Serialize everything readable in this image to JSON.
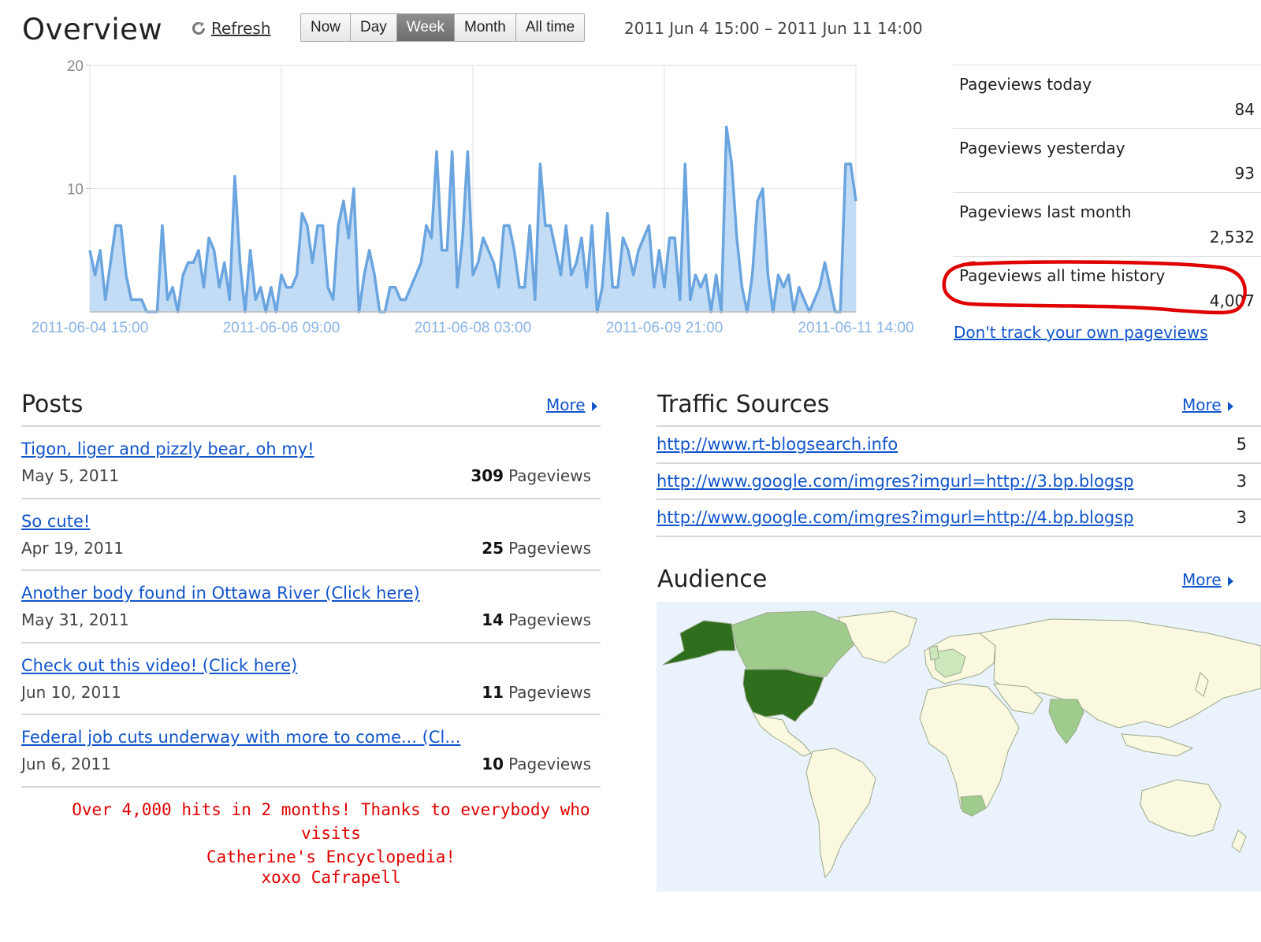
{
  "header": {
    "title": "Overview",
    "refresh_label": "Refresh",
    "ranges": [
      {
        "label": "Now",
        "active": false
      },
      {
        "label": "Day",
        "active": false
      },
      {
        "label": "Week",
        "active": true
      },
      {
        "label": "Month",
        "active": false
      },
      {
        "label": "All time",
        "active": false
      }
    ],
    "date_range": "2011 Jun 4 15:00 – 2011 Jun 11 14:00"
  },
  "chart_data": {
    "type": "area",
    "ylim": [
      0,
      20
    ],
    "yticks": [
      "20",
      "10"
    ],
    "xtick_labels": [
      "2011-06-04 15:00",
      "2011-06-06 09:00",
      "2011-06-08 03:00",
      "2011-06-09 21:00",
      "2011-06-11 14:00"
    ],
    "x_range": [
      "2011-06-04 15:00",
      "2011-06-11 14:00"
    ],
    "grid": true,
    "colors": {
      "line": "#6aa5e0",
      "fill": "#c3dcf5",
      "grid": "#e2e2e2",
      "axis": "#bbbbbb",
      "xtick": "#8ab4e6"
    },
    "values": [
      5,
      3,
      5,
      1,
      4,
      7,
      7,
      3,
      1,
      1,
      1,
      0,
      0,
      0,
      7,
      1,
      2,
      0,
      3,
      4,
      4,
      5,
      2,
      6,
      5,
      2,
      4,
      1,
      11,
      4,
      0,
      5,
      1,
      2,
      0,
      2,
      0,
      3,
      2,
      2,
      3,
      8,
      7,
      4,
      7,
      7,
      2,
      1,
      7,
      9,
      6,
      10,
      0,
      3,
      5,
      3,
      0,
      0,
      2,
      2,
      1,
      1,
      2,
      3,
      4,
      7,
      6,
      13,
      5,
      5,
      13,
      2,
      6,
      13,
      3,
      4,
      6,
      5,
      4,
      2,
      7,
      7,
      5,
      2,
      2,
      7,
      1,
      12,
      7,
      7,
      5,
      3,
      7,
      3,
      4,
      6,
      2,
      7,
      0,
      2,
      8,
      2,
      2,
      6,
      5,
      3,
      5,
      6,
      7,
      2,
      5,
      2,
      6,
      6,
      1,
      12,
      1,
      3,
      2,
      3,
      0,
      3,
      0,
      15,
      12,
      6,
      2,
      0,
      3,
      9,
      10,
      3,
      0,
      3,
      2,
      3,
      0,
      2,
      1,
      0,
      1,
      2,
      4,
      2,
      0,
      0,
      12,
      12,
      9
    ],
    "series": [
      {
        "values_ref": "values"
      }
    ]
  },
  "stats": [
    {
      "label": "Pageviews today",
      "value": "84"
    },
    {
      "label": "Pageviews yesterday",
      "value": "93"
    },
    {
      "label": "Pageviews last month",
      "value": "2,532"
    },
    {
      "label": "Pageviews all time history",
      "value": "4,007",
      "highlighted": true
    }
  ],
  "dont_track_label": "Don't track your own pageviews",
  "posts": {
    "title": "Posts",
    "more_label": "More",
    "items": [
      {
        "title": "Tigon, liger and pizzly bear, oh my!",
        "date": "May 5, 2011",
        "count": "309",
        "unit": "Pageviews"
      },
      {
        "title": "So cute!",
        "date": "Apr 19, 2011",
        "count": "25",
        "unit": "Pageviews"
      },
      {
        "title": "Another body found in Ottawa River (Click here)",
        "date": "May 31, 2011",
        "count": "14",
        "unit": "Pageviews"
      },
      {
        "title": "Check out this video! (Click here)",
        "date": "Jun 10, 2011",
        "count": "11",
        "unit": "Pageviews"
      },
      {
        "title": "Federal job cuts underway with more to come... (Cl...",
        "date": "Jun 6, 2011",
        "count": "10",
        "unit": "Pageviews"
      }
    ]
  },
  "note": {
    "line1": "Over 4,000 hits in 2 months! Thanks to everybody who visits",
    "line2": "Catherine's Encyclopedia!",
    "sign": "xoxo Cafrapell",
    "color": "#e00000"
  },
  "traffic": {
    "title": "Traffic Sources",
    "more_label": "More",
    "items": [
      {
        "url": "http://www.rt-blogsearch.info",
        "count": "5"
      },
      {
        "url": "http://www.google.com/imgres?imgurl=http://3.bp.blogsp",
        "count": "3"
      },
      {
        "url": "http://www.google.com/imgres?imgurl=http://4.bp.blogsp",
        "count": "3"
      }
    ]
  },
  "audience": {
    "title": "Audience",
    "more_label": "More",
    "colors": {
      "ocean": "#eaf3fb",
      "land": "#fbf8e0",
      "border": "#9aa88a",
      "high": "#2e6e1d",
      "mid": "#9fcc8c",
      "low": "#cde8bd"
    }
  },
  "accent": {
    "link": "#1155cc",
    "highlight_ring": "#e00000"
  }
}
